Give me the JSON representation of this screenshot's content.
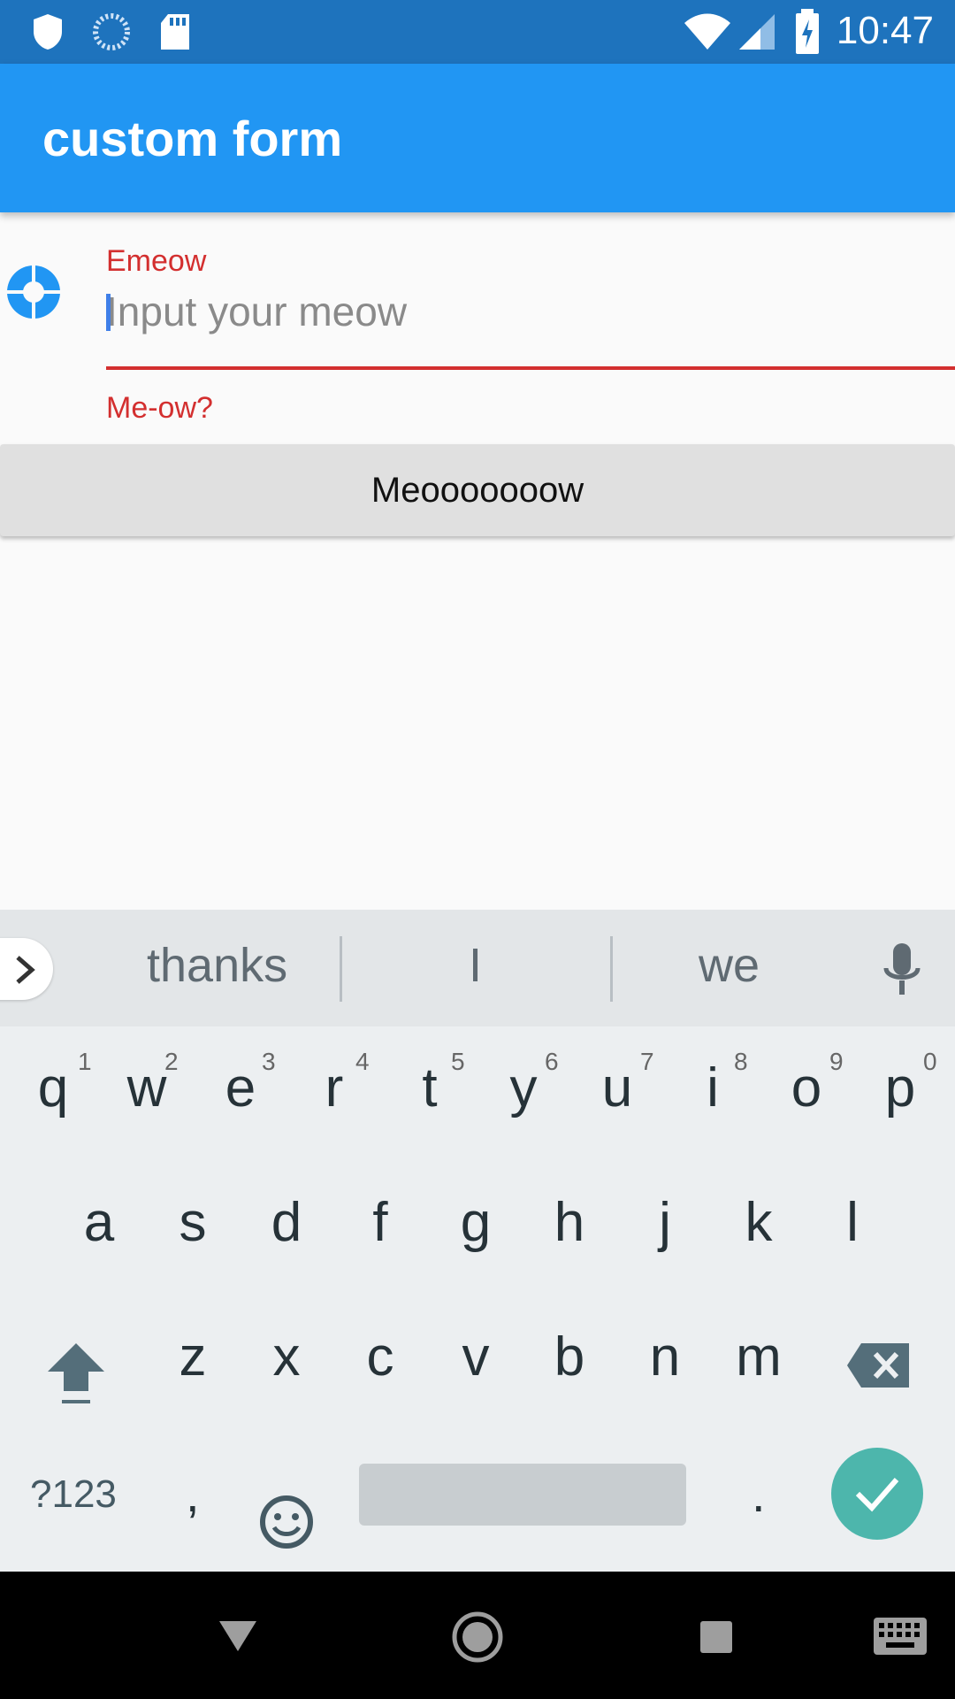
{
  "status_bar": {
    "time": "10:47"
  },
  "app_bar": {
    "title": "custom form"
  },
  "form": {
    "label": "Emeow",
    "placeholder": "Input your meow",
    "error": "Me-ow?",
    "submit_label": "Meooooooow"
  },
  "keyboard": {
    "suggestions": [
      "thanks",
      "I",
      "we"
    ],
    "row1": [
      "q",
      "w",
      "e",
      "r",
      "t",
      "y",
      "u",
      "i",
      "o",
      "p"
    ],
    "row1_hints": [
      "1",
      "2",
      "3",
      "4",
      "5",
      "6",
      "7",
      "8",
      "9",
      "0"
    ],
    "row2": [
      "a",
      "s",
      "d",
      "f",
      "g",
      "h",
      "j",
      "k",
      "l"
    ],
    "row3": [
      "z",
      "x",
      "c",
      "v",
      "b",
      "n",
      "m"
    ],
    "symbols_label": "?123",
    "comma_label": ",",
    "period_label": "."
  },
  "colors": {
    "primary": "#2196f3",
    "status_bar": "#1e73bd",
    "error": "#d32f2f",
    "enter_key": "#4db6ac"
  }
}
